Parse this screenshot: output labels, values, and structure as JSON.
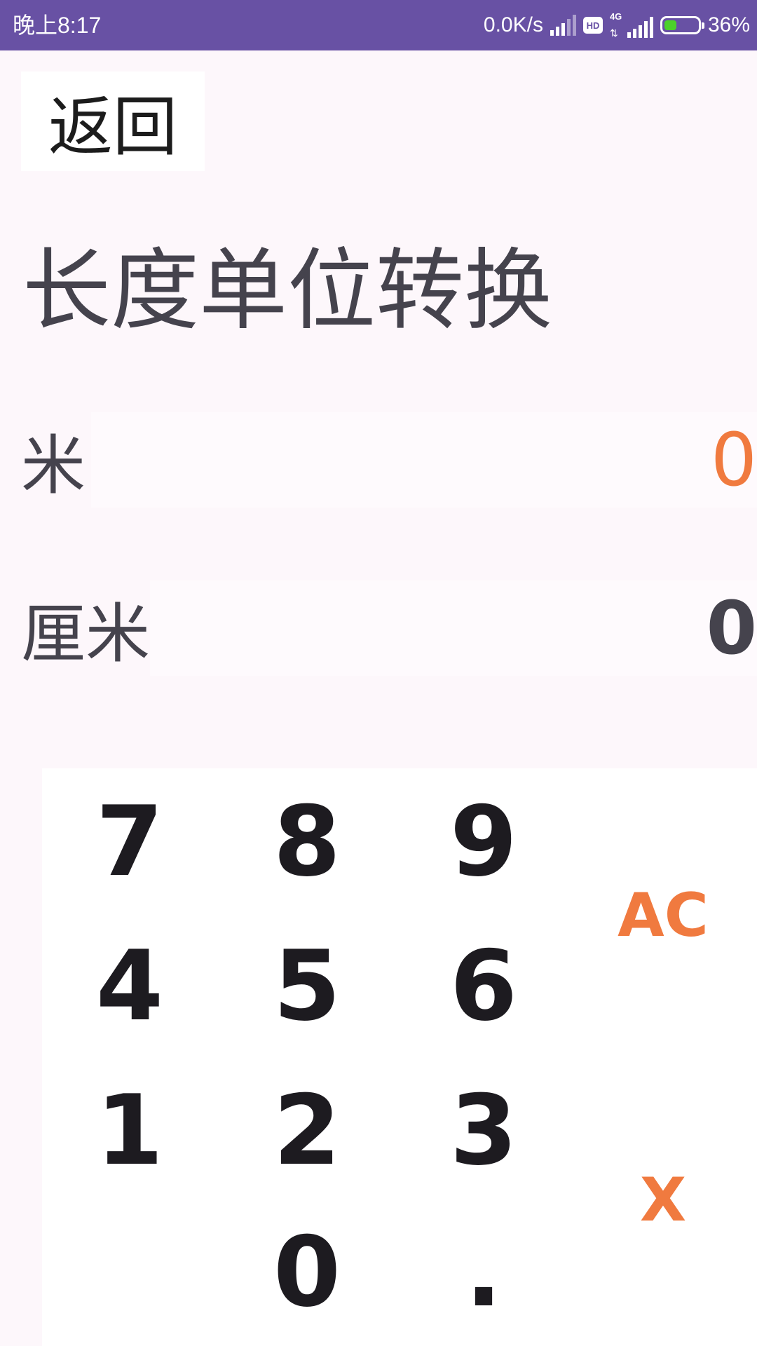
{
  "status_bar": {
    "time": "晚上8:17",
    "net_speed": "0.0K/s",
    "hd_label": "HD",
    "network_type": "4G",
    "battery_percent": "36%",
    "battery_level": 0.36,
    "battery_color": "#4cd12a",
    "background_color": "#6851a4"
  },
  "header": {
    "back_label": "返回"
  },
  "page": {
    "title": "长度单位转换"
  },
  "units": [
    {
      "label": "米",
      "value": "0",
      "active": true
    },
    {
      "label": "厘米",
      "value": "0",
      "active": false
    }
  ],
  "keypad": {
    "keys": [
      "7",
      "8",
      "9",
      "4",
      "5",
      "6",
      "1",
      "2",
      "3",
      "0",
      "."
    ],
    "clear_label": "AC",
    "delete_label": "X",
    "accent_color": "#f07a3f"
  }
}
